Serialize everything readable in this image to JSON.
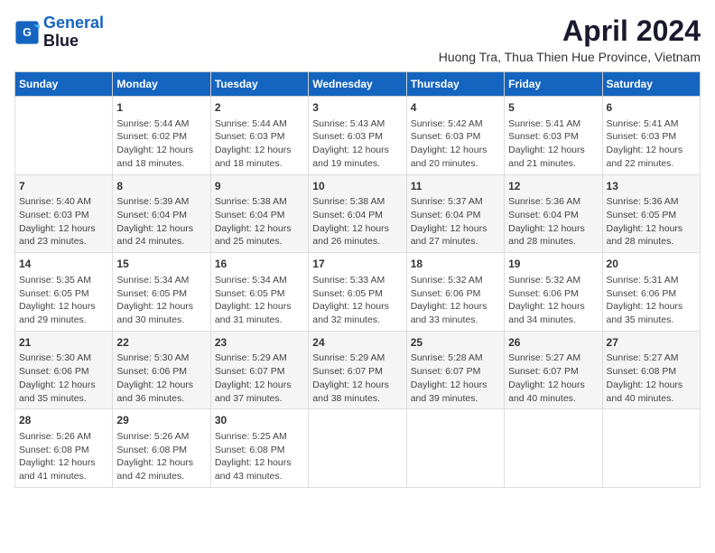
{
  "logo": {
    "line1": "General",
    "line2": "Blue"
  },
  "title": "April 2024",
  "subtitle": "Huong Tra, Thua Thien Hue Province, Vietnam",
  "weekdays": [
    "Sunday",
    "Monday",
    "Tuesday",
    "Wednesday",
    "Thursday",
    "Friday",
    "Saturday"
  ],
  "weeks": [
    [
      {
        "day": "",
        "lines": []
      },
      {
        "day": "1",
        "lines": [
          "Sunrise: 5:44 AM",
          "Sunset: 6:02 PM",
          "Daylight: 12 hours",
          "and 18 minutes."
        ]
      },
      {
        "day": "2",
        "lines": [
          "Sunrise: 5:44 AM",
          "Sunset: 6:03 PM",
          "Daylight: 12 hours",
          "and 18 minutes."
        ]
      },
      {
        "day": "3",
        "lines": [
          "Sunrise: 5:43 AM",
          "Sunset: 6:03 PM",
          "Daylight: 12 hours",
          "and 19 minutes."
        ]
      },
      {
        "day": "4",
        "lines": [
          "Sunrise: 5:42 AM",
          "Sunset: 6:03 PM",
          "Daylight: 12 hours",
          "and 20 minutes."
        ]
      },
      {
        "day": "5",
        "lines": [
          "Sunrise: 5:41 AM",
          "Sunset: 6:03 PM",
          "Daylight: 12 hours",
          "and 21 minutes."
        ]
      },
      {
        "day": "6",
        "lines": [
          "Sunrise: 5:41 AM",
          "Sunset: 6:03 PM",
          "Daylight: 12 hours",
          "and 22 minutes."
        ]
      }
    ],
    [
      {
        "day": "7",
        "lines": [
          "Sunrise: 5:40 AM",
          "Sunset: 6:03 PM",
          "Daylight: 12 hours",
          "and 23 minutes."
        ]
      },
      {
        "day": "8",
        "lines": [
          "Sunrise: 5:39 AM",
          "Sunset: 6:04 PM",
          "Daylight: 12 hours",
          "and 24 minutes."
        ]
      },
      {
        "day": "9",
        "lines": [
          "Sunrise: 5:38 AM",
          "Sunset: 6:04 PM",
          "Daylight: 12 hours",
          "and 25 minutes."
        ]
      },
      {
        "day": "10",
        "lines": [
          "Sunrise: 5:38 AM",
          "Sunset: 6:04 PM",
          "Daylight: 12 hours",
          "and 26 minutes."
        ]
      },
      {
        "day": "11",
        "lines": [
          "Sunrise: 5:37 AM",
          "Sunset: 6:04 PM",
          "Daylight: 12 hours",
          "and 27 minutes."
        ]
      },
      {
        "day": "12",
        "lines": [
          "Sunrise: 5:36 AM",
          "Sunset: 6:04 PM",
          "Daylight: 12 hours",
          "and 28 minutes."
        ]
      },
      {
        "day": "13",
        "lines": [
          "Sunrise: 5:36 AM",
          "Sunset: 6:05 PM",
          "Daylight: 12 hours",
          "and 28 minutes."
        ]
      }
    ],
    [
      {
        "day": "14",
        "lines": [
          "Sunrise: 5:35 AM",
          "Sunset: 6:05 PM",
          "Daylight: 12 hours",
          "and 29 minutes."
        ]
      },
      {
        "day": "15",
        "lines": [
          "Sunrise: 5:34 AM",
          "Sunset: 6:05 PM",
          "Daylight: 12 hours",
          "and 30 minutes."
        ]
      },
      {
        "day": "16",
        "lines": [
          "Sunrise: 5:34 AM",
          "Sunset: 6:05 PM",
          "Daylight: 12 hours",
          "and 31 minutes."
        ]
      },
      {
        "day": "17",
        "lines": [
          "Sunrise: 5:33 AM",
          "Sunset: 6:05 PM",
          "Daylight: 12 hours",
          "and 32 minutes."
        ]
      },
      {
        "day": "18",
        "lines": [
          "Sunrise: 5:32 AM",
          "Sunset: 6:06 PM",
          "Daylight: 12 hours",
          "and 33 minutes."
        ]
      },
      {
        "day": "19",
        "lines": [
          "Sunrise: 5:32 AM",
          "Sunset: 6:06 PM",
          "Daylight: 12 hours",
          "and 34 minutes."
        ]
      },
      {
        "day": "20",
        "lines": [
          "Sunrise: 5:31 AM",
          "Sunset: 6:06 PM",
          "Daylight: 12 hours",
          "and 35 minutes."
        ]
      }
    ],
    [
      {
        "day": "21",
        "lines": [
          "Sunrise: 5:30 AM",
          "Sunset: 6:06 PM",
          "Daylight: 12 hours",
          "and 35 minutes."
        ]
      },
      {
        "day": "22",
        "lines": [
          "Sunrise: 5:30 AM",
          "Sunset: 6:06 PM",
          "Daylight: 12 hours",
          "and 36 minutes."
        ]
      },
      {
        "day": "23",
        "lines": [
          "Sunrise: 5:29 AM",
          "Sunset: 6:07 PM",
          "Daylight: 12 hours",
          "and 37 minutes."
        ]
      },
      {
        "day": "24",
        "lines": [
          "Sunrise: 5:29 AM",
          "Sunset: 6:07 PM",
          "Daylight: 12 hours",
          "and 38 minutes."
        ]
      },
      {
        "day": "25",
        "lines": [
          "Sunrise: 5:28 AM",
          "Sunset: 6:07 PM",
          "Daylight: 12 hours",
          "and 39 minutes."
        ]
      },
      {
        "day": "26",
        "lines": [
          "Sunrise: 5:27 AM",
          "Sunset: 6:07 PM",
          "Daylight: 12 hours",
          "and 40 minutes."
        ]
      },
      {
        "day": "27",
        "lines": [
          "Sunrise: 5:27 AM",
          "Sunset: 6:08 PM",
          "Daylight: 12 hours",
          "and 40 minutes."
        ]
      }
    ],
    [
      {
        "day": "28",
        "lines": [
          "Sunrise: 5:26 AM",
          "Sunset: 6:08 PM",
          "Daylight: 12 hours",
          "and 41 minutes."
        ]
      },
      {
        "day": "29",
        "lines": [
          "Sunrise: 5:26 AM",
          "Sunset: 6:08 PM",
          "Daylight: 12 hours",
          "and 42 minutes."
        ]
      },
      {
        "day": "30",
        "lines": [
          "Sunrise: 5:25 AM",
          "Sunset: 6:08 PM",
          "Daylight: 12 hours",
          "and 43 minutes."
        ]
      },
      {
        "day": "",
        "lines": []
      },
      {
        "day": "",
        "lines": []
      },
      {
        "day": "",
        "lines": []
      },
      {
        "day": "",
        "lines": []
      }
    ]
  ]
}
